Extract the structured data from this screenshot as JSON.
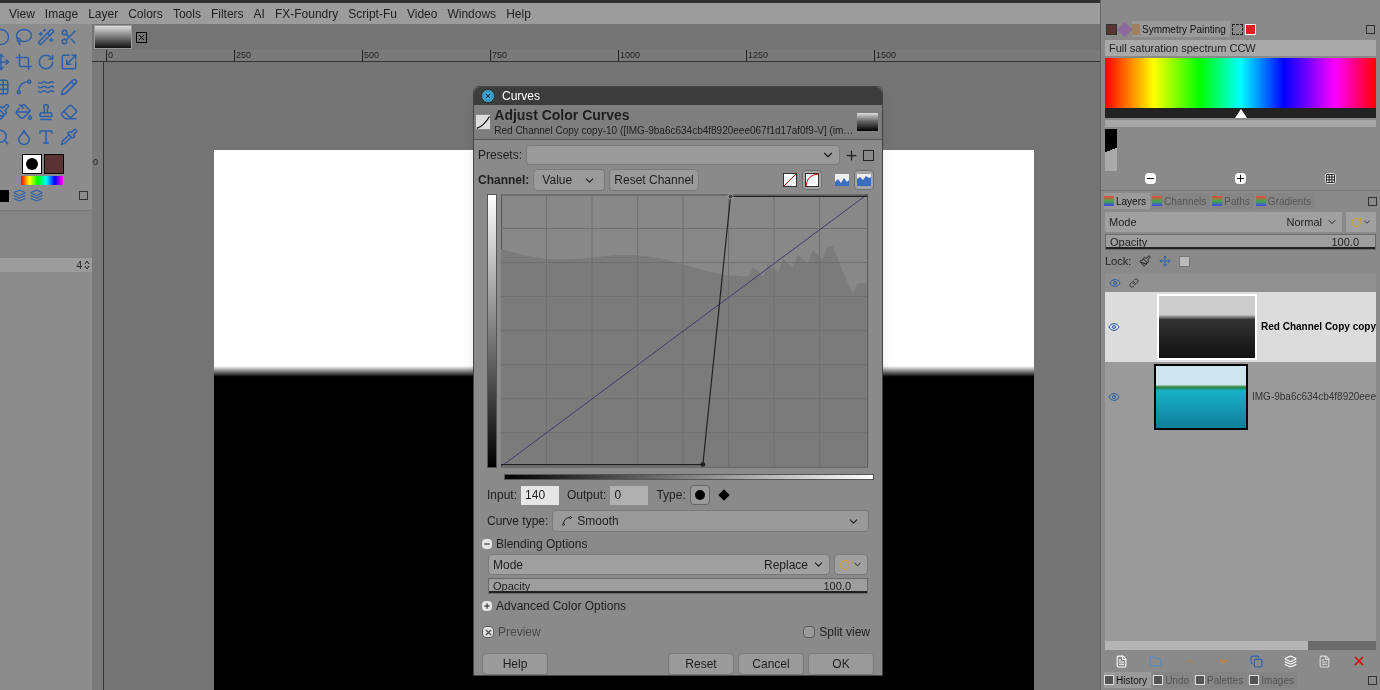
{
  "menu": [
    "View",
    "Image",
    "Layer",
    "Colors",
    "Tools",
    "Filters",
    "AI",
    "FX-Foundry",
    "Script-Fu",
    "Video",
    "Windows",
    "Help"
  ],
  "tool_options": {
    "value": "4"
  },
  "ruler": {
    "horizontal": [
      "0",
      "250",
      "500",
      "750",
      "1000",
      "1250",
      "1500"
    ],
    "vertical": [
      "0"
    ]
  },
  "curves_dialog": {
    "title": "Curves",
    "heading": "Adjust Color Curves",
    "subtitle": "Red Channel Copy copy-10 ([IMG-9ba6c634cb4f8920eee067f1d17af0f9-V] (im…",
    "presets_label": "Presets:",
    "channel_label": "Channel:",
    "channel": "Value",
    "reset_channel": "Reset Channel",
    "curve_scale": [
      {
        "kind": "linear",
        "selected": false
      },
      {
        "kind": "log",
        "selected": true
      }
    ],
    "histogram_scale": [
      {
        "kind": "linear",
        "selected": false
      },
      {
        "kind": "log",
        "selected": true
      }
    ],
    "input_label": "Input:",
    "input": "140",
    "output_label": "Output:",
    "output": "0",
    "type_label": "Type:",
    "point_types": [
      {
        "kind": "smooth",
        "selected": true
      },
      {
        "kind": "corner",
        "selected": false
      }
    ],
    "curve_type_label": "Curve type:",
    "curve_type": "Smooth",
    "blending": {
      "title": "Blending Options",
      "expanded": true,
      "mode_label": "Mode",
      "mode": "Replace",
      "opacity_label": "Opacity",
      "opacity": "100.0",
      "level": 1
    },
    "advanced": {
      "title": "Advanced Color Options",
      "expanded": false
    },
    "preview": {
      "label": "Preview",
      "checked": true,
      "disabled": true
    },
    "split_view": {
      "label": "Split view",
      "checked": false
    },
    "buttons": [
      "Help",
      "Reset",
      "Cancel",
      "OK"
    ]
  },
  "right_panel": {
    "tabs": [
      {
        "label": "Symmetry Painting",
        "selected": true
      }
    ],
    "gradient_name": "Full saturation spectrum CCW",
    "dock_tabs": [
      {
        "label": "Layers",
        "selected": true
      },
      {
        "label": "Channels",
        "selected": false
      },
      {
        "label": "Paths",
        "selected": false
      },
      {
        "label": "Gradients",
        "selected": false
      }
    ],
    "mode_label": "Mode",
    "mode": "Normal",
    "opacity_label": "Opacity",
    "opacity": "100.0",
    "level": 1,
    "lock_label": "Lock:",
    "layers": [
      {
        "name": "Red Channel Copy copy",
        "kind": "grayscale",
        "selected": true,
        "visible": true
      },
      {
        "name": "IMG-9ba6c634cb4f8920eee",
        "kind": "color",
        "selected": false,
        "visible": true
      }
    ],
    "bottom_tabs": [
      {
        "label": "History",
        "selected": true
      },
      {
        "label": "Undo",
        "selected": false
      },
      {
        "label": "Palettes",
        "selected": false
      },
      {
        "label": "Images",
        "selected": false
      }
    ]
  }
}
